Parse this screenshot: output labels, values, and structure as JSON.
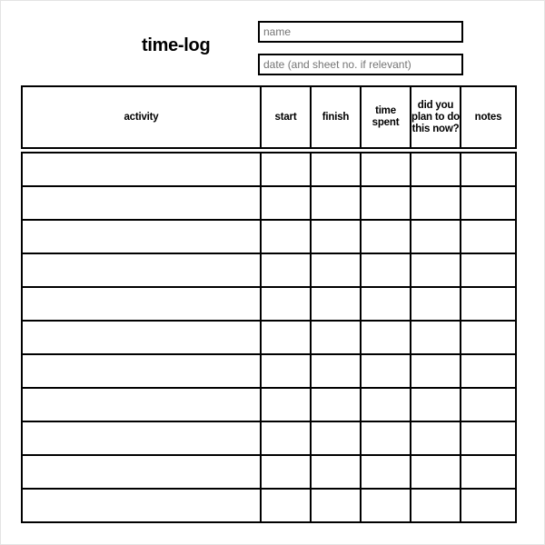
{
  "document": {
    "title": "time-log"
  },
  "fields": [
    {
      "id": "name",
      "name": "name-field",
      "placeholder": "name",
      "value": ""
    },
    {
      "id": "date",
      "name": "date-field",
      "placeholder": "date (and sheet no. if relevant)",
      "value": ""
    }
  ],
  "table": {
    "columns": [
      {
        "key": "activity",
        "label": "activity"
      },
      {
        "key": "start",
        "label": "start"
      },
      {
        "key": "finish",
        "label": "finish"
      },
      {
        "key": "spent",
        "label": "time spent"
      },
      {
        "key": "plan",
        "label": "did you plan to do this now?"
      },
      {
        "key": "notes",
        "label": "notes"
      }
    ],
    "row_count": 11,
    "rows": [
      {
        "activity": "",
        "start": "",
        "finish": "",
        "spent": "",
        "plan": "",
        "notes": ""
      },
      {
        "activity": "",
        "start": "",
        "finish": "",
        "spent": "",
        "plan": "",
        "notes": ""
      },
      {
        "activity": "",
        "start": "",
        "finish": "",
        "spent": "",
        "plan": "",
        "notes": ""
      },
      {
        "activity": "",
        "start": "",
        "finish": "",
        "spent": "",
        "plan": "",
        "notes": ""
      },
      {
        "activity": "",
        "start": "",
        "finish": "",
        "spent": "",
        "plan": "",
        "notes": ""
      },
      {
        "activity": "",
        "start": "",
        "finish": "",
        "spent": "",
        "plan": "",
        "notes": ""
      },
      {
        "activity": "",
        "start": "",
        "finish": "",
        "spent": "",
        "plan": "",
        "notes": ""
      },
      {
        "activity": "",
        "start": "",
        "finish": "",
        "spent": "",
        "plan": "",
        "notes": ""
      },
      {
        "activity": "",
        "start": "",
        "finish": "",
        "spent": "",
        "plan": "",
        "notes": ""
      },
      {
        "activity": "",
        "start": "",
        "finish": "",
        "spent": "",
        "plan": "",
        "notes": ""
      },
      {
        "activity": "",
        "start": "",
        "finish": "",
        "spent": "",
        "plan": "",
        "notes": ""
      }
    ]
  },
  "colors": {
    "ink": "#000000",
    "paper": "#ffffff",
    "page_border": "#e3e3e3"
  }
}
